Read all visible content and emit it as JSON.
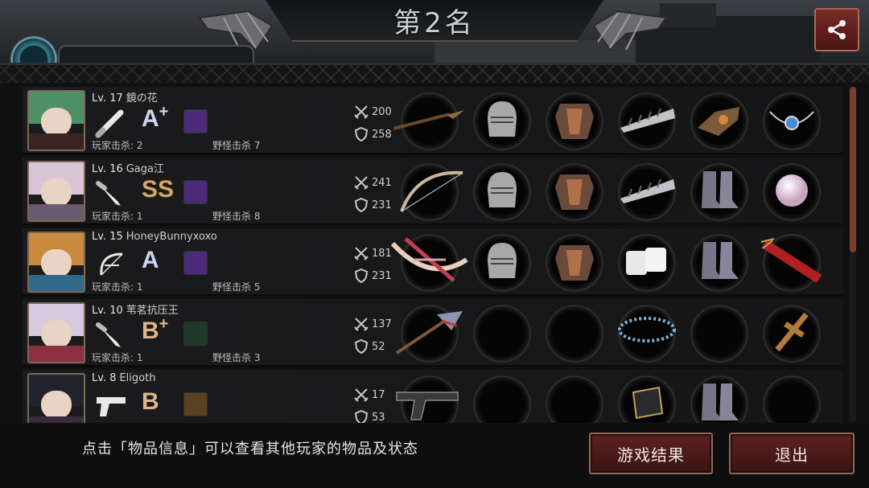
{
  "header": {
    "title": "第2名"
  },
  "icons": {
    "share": "share-icon",
    "attack": "crossed-swords-icon",
    "defense": "shield-icon"
  },
  "players": [
    {
      "level": "Lv. 17",
      "name": "鏡の花",
      "weapon_type": "baseball-bat-icon",
      "rank": "A",
      "rank_sup": "+",
      "rank_color": "#c9d8f0",
      "skill_color": "#4b2a7a",
      "player_kills": "玩家击杀: 2",
      "monster_kills": "野怪击杀 7",
      "attack": "200",
      "defense": "258",
      "hair": "#4f8f66",
      "outfit": "#3a2320",
      "slots": [
        "spear-icon",
        "helmet-icon",
        "chest-armor-icon",
        "arm-guard-icon",
        "gauntlet-icon",
        "amulet-icon"
      ]
    },
    {
      "level": "Lv. 16",
      "name": "Gaga江",
      "weapon_type": "knife-icon",
      "rank": "SS",
      "rank_sup": "",
      "rank_color": "#d9a55e",
      "skill_color": "#4b2a7a",
      "player_kills": "玩家击杀: 1",
      "monster_kills": "野怪击杀 8",
      "attack": "241",
      "defense": "231",
      "hair": "#d8c6d8",
      "outfit": "#6a5a70",
      "slots": [
        "bow-icon",
        "helmet-icon",
        "chest-armor-icon",
        "arm-guard-icon",
        "boots-icon",
        "pearl-icon"
      ]
    },
    {
      "level": "Lv. 15",
      "name": "HoneyBunnyxoxo",
      "weapon_type": "bow-icon",
      "rank": "A",
      "rank_sup": "",
      "rank_color": "#c9d8f0",
      "skill_color": "#4b2a7a",
      "player_kills": "玩家击杀: 1",
      "monster_kills": "野怪击杀 5",
      "attack": "181",
      "defense": "231",
      "hair": "#c98a3e",
      "outfit": "#2f6a8a",
      "slots": [
        "crossbow-icon",
        "helmet-icon",
        "chest-armor-icon",
        "bandage-icon",
        "boots-icon",
        "quiver-icon"
      ]
    },
    {
      "level": "Lv. 10",
      "name": "苇茗抗压王",
      "weapon_type": "knife-icon",
      "rank": "B",
      "rank_sup": "+",
      "rank_color": "#e0b48a",
      "skill_color": "#1f3a2a",
      "player_kills": "玩家击杀: 1",
      "monster_kills": "野怪击杀 3",
      "attack": "137",
      "defense": "52",
      "hair": "#d9c9de",
      "outfit": "#8a3040",
      "slots": [
        "axe-icon",
        "",
        "",
        "necklace-icon",
        "",
        "cross-icon"
      ]
    },
    {
      "level": "Lv. 8",
      "name": "Eligoth",
      "weapon_type": "pistol-icon",
      "rank": "B",
      "rank_sup": "",
      "rank_color": "#e0b48a",
      "skill_color": "#5a4220",
      "player_kills": "",
      "monster_kills": "",
      "attack": "17",
      "defense": "53",
      "hair": "#20222e",
      "outfit": "#3a2a3a",
      "slots": [
        "pistol-icon",
        "",
        "",
        "bracer-icon",
        "boots-icon",
        ""
      ]
    }
  ],
  "footer": {
    "hint": "点击「物品信息」可以查看其他玩家的物品及状态",
    "result_button": "游戏结果",
    "exit_button": "退出"
  }
}
